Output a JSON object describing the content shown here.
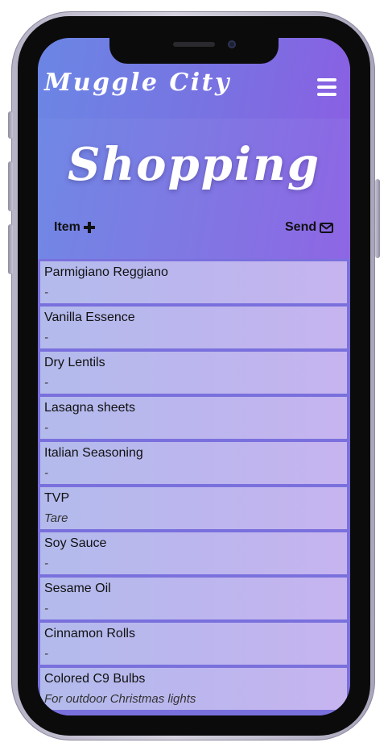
{
  "app": {
    "brand": "Muggle City",
    "menu_icon": "hamburger-menu-icon"
  },
  "page": {
    "title": "Shopping"
  },
  "actions": {
    "add_item_label": "Item",
    "add_item_icon": "plus-icon",
    "send_label": "Send",
    "send_icon": "envelope-icon"
  },
  "items": [
    {
      "name": "Parmigiano Reggiano",
      "note": "-"
    },
    {
      "name": "Vanilla Essence",
      "note": "-"
    },
    {
      "name": "Dry Lentils",
      "note": "-"
    },
    {
      "name": "Lasagna sheets",
      "note": "-"
    },
    {
      "name": "Italian Seasoning",
      "note": "-"
    },
    {
      "name": "TVP",
      "note": "Tare"
    },
    {
      "name": "Soy Sauce",
      "note": "-"
    },
    {
      "name": "Sesame Oil",
      "note": "-"
    },
    {
      "name": "Cinnamon Rolls",
      "note": "-"
    },
    {
      "name": "Colored C9 Bulbs",
      "note": "For outdoor Christmas lights"
    }
  ],
  "colors": {
    "header_gradient_start": "#6a83e3",
    "header_gradient_end": "#8a5ee2",
    "list_item_bg": "#bcb6ee",
    "list_separator": "#7a70dd"
  }
}
